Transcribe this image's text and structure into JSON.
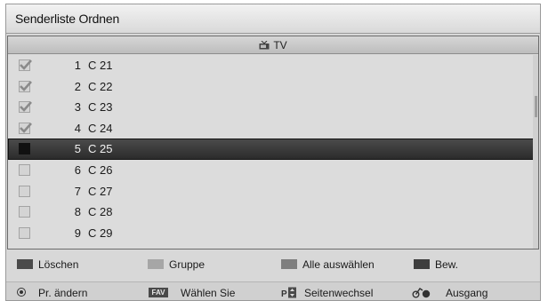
{
  "title": "Senderliste Ordnen",
  "list_header": {
    "label": "TV"
  },
  "channels": [
    {
      "number": "1",
      "name": "C 21",
      "checked": true
    },
    {
      "number": "2",
      "name": "C 22",
      "checked": true
    },
    {
      "number": "3",
      "name": "C 23",
      "checked": true
    },
    {
      "number": "4",
      "name": "C 24",
      "checked": true
    },
    {
      "number": "5",
      "name": "C 25",
      "checked": false,
      "selected": true
    },
    {
      "number": "6",
      "name": "C 26",
      "checked": false
    },
    {
      "number": "7",
      "name": "C 27",
      "checked": false
    },
    {
      "number": "8",
      "name": "C 28",
      "checked": false
    },
    {
      "number": "9",
      "name": "C 29",
      "checked": false
    }
  ],
  "color_keys": [
    {
      "label": "Löschen",
      "color": "#4b4b4b"
    },
    {
      "label": "Gruppe",
      "color": "#a6a6a6"
    },
    {
      "label": "Alle auswählen",
      "color": "#7e7e7e"
    },
    {
      "label": "Bew.",
      "color": "#3e3e3e"
    }
  ],
  "function_keys": [
    {
      "label": "Pr. ändern",
      "icon": "ok-icon"
    },
    {
      "label": "Wählen Sie",
      "icon": "fav-icon",
      "icon_text": "FAV"
    },
    {
      "label": "Seitenwechsel",
      "icon": "page-updown-icon"
    },
    {
      "label": "Ausgang",
      "icon": "exit-icon"
    }
  ]
}
